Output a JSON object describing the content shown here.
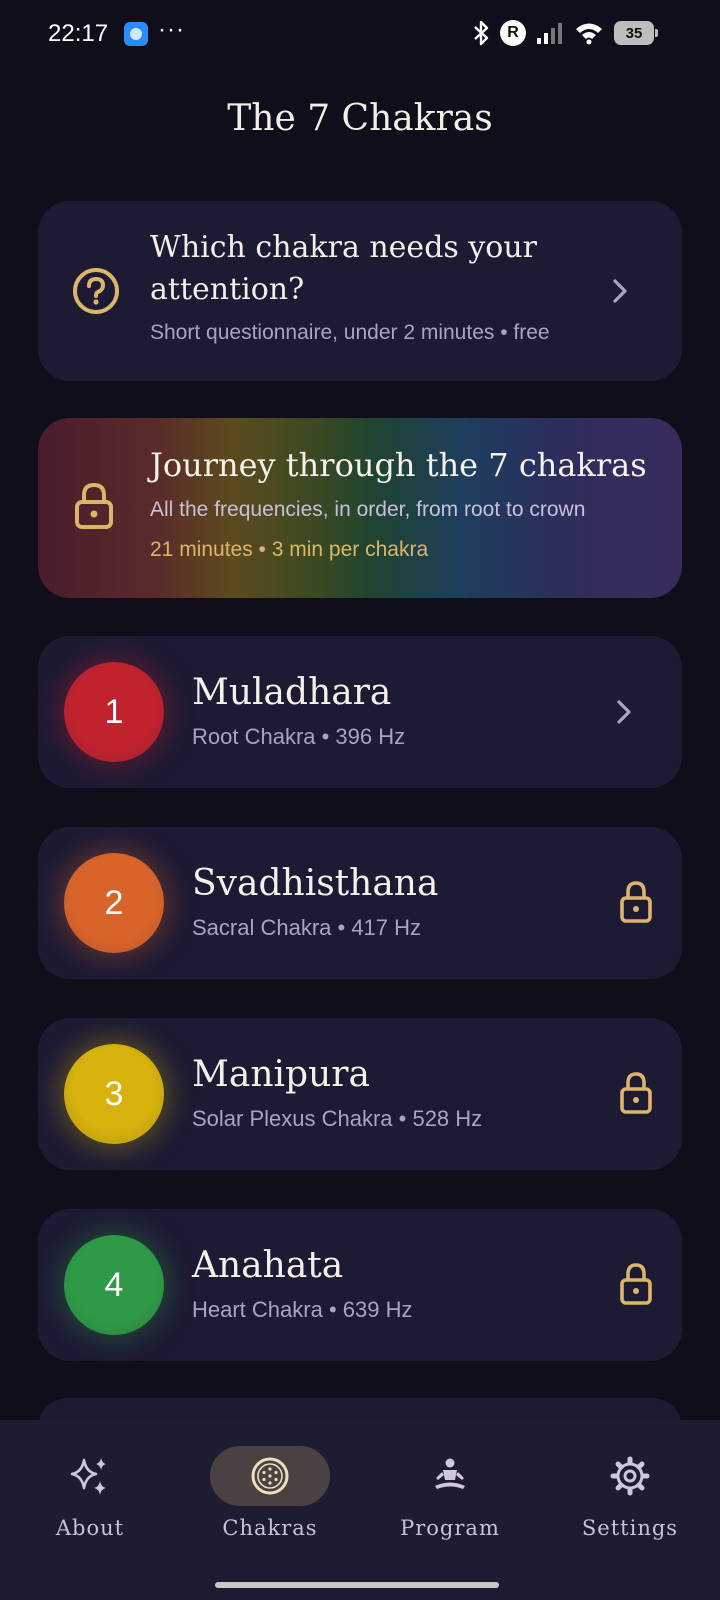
{
  "status_bar": {
    "time": "22:17",
    "dots": "···",
    "battery": "35",
    "r_badge": "R"
  },
  "header": {
    "title": "The 7 Chakras"
  },
  "quiz_card": {
    "title": "Which chakra needs your attention?",
    "subtitle": "Short questionnaire, under 2 minutes • free"
  },
  "journey_card": {
    "title": "Journey through the 7 chakras",
    "subtitle": "All the frequencies, in order, from root to crown",
    "meta": "21 minutes • 3 min per chakra"
  },
  "chakras": [
    {
      "number": "1",
      "name": "Muladhara",
      "subtitle": "Root Chakra • 396 Hz",
      "color": "#c0222e",
      "locked": false
    },
    {
      "number": "2",
      "name": "Svadhisthana",
      "subtitle": "Sacral Chakra • 417 Hz",
      "color": "#d9642a",
      "locked": true
    },
    {
      "number": "3",
      "name": "Manipura",
      "subtitle": "Solar Plexus Chakra • 528 Hz",
      "color": "#d6b20c",
      "locked": true
    },
    {
      "number": "4",
      "name": "Anahata",
      "subtitle": "Heart Chakra • 639 Hz",
      "color": "#2e9a45",
      "locked": true
    }
  ],
  "nav": {
    "items": [
      {
        "label": "About",
        "icon": "sparkles-icon",
        "active": false
      },
      {
        "label": "Chakras",
        "icon": "mandala-icon",
        "active": true
      },
      {
        "label": "Program",
        "icon": "meditation-icon",
        "active": false
      },
      {
        "label": "Settings",
        "icon": "gear-icon",
        "active": false
      }
    ]
  },
  "colors": {
    "accent_gold": "#dcb46a",
    "background": "#100e1a",
    "card": "#1d1a33"
  }
}
